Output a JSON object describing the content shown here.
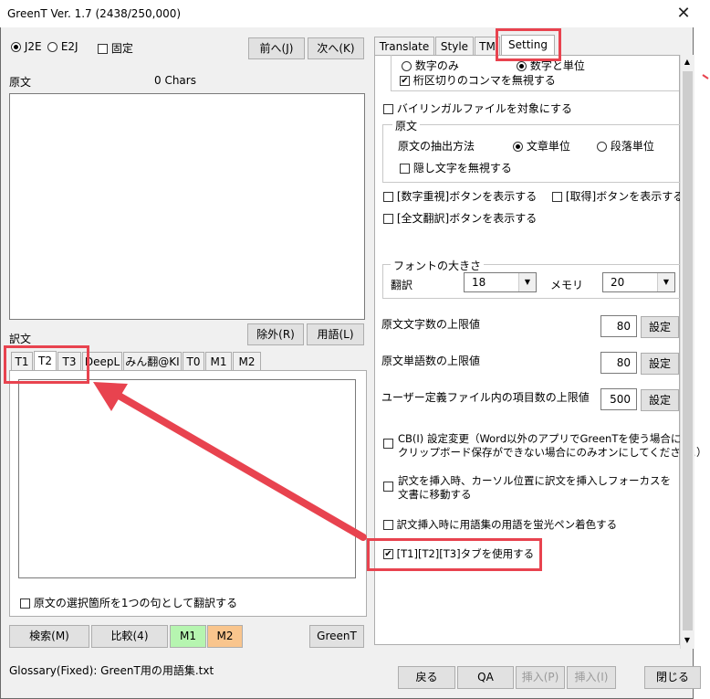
{
  "window": {
    "title": "GreenT Ver. 1.7 (2438/250,000)",
    "close_glyph": "✕"
  },
  "left": {
    "radio_j2e": "J2E",
    "radio_e2j": "E2J",
    "fixed_checkbox": "固定",
    "prev_button": "前へ(J)",
    "next_button": "次へ(K)",
    "source_label": "原文",
    "char_count": "0 Chars",
    "exclude_button": "除外(R)",
    "terms_button": "用語(L)",
    "translation_label": "訳文",
    "tabs": [
      "T1",
      "T2",
      "T3",
      "DeepL",
      "みん翻@KI",
      "T0",
      "M1",
      "M2"
    ],
    "translate_selection_checkbox": "原文の選択箇所を1つの句として翻訳する",
    "search_button": "検索(M)",
    "compare_button": "比較(4)",
    "m1_button": "M1",
    "m2_button": "M2",
    "greent_button": "GreenT"
  },
  "status": {
    "glossary": "Glossary(Fixed): GreenT用の用語集.txt",
    "back_button": "戻る",
    "qa_button": "QA",
    "insert_p_button": "挿入(P)",
    "insert_i_button": "挿入(I)",
    "close_button": "閉じる"
  },
  "right": {
    "tabs": [
      "Translate",
      "Style",
      "TM",
      "Setting"
    ],
    "numbers_only": "数字のみ",
    "numbers_units": "数字と単位",
    "ignore_comma": "桁区切りのコンマを無視する",
    "bilingual": "バイリンガルファイルを対象にする",
    "source_group": "原文",
    "extract_method": "原文の抽出方法",
    "sentence_unit": "文章単位",
    "paragraph_unit": "段落単位",
    "ignore_hidden": "隠し文字を無視する",
    "show_number_button": "[数字重視]ボタンを表示する",
    "show_get_button": "[取得]ボタンを表示する",
    "show_full_button": "[全文翻訳]ボタンを表示する",
    "font_group": "フォントの大きさ",
    "translation_font_label": "翻訳",
    "translation_font_value": "18",
    "memory_font_label": "メモリ",
    "memory_font_value": "20",
    "source_char_limit": "原文文字数の上限値",
    "source_char_value": "80",
    "source_word_limit": "原文単語数の上限値",
    "source_word_value": "80",
    "user_def_limit": "ユーザー定義ファイル内の項目数の上限値",
    "user_def_value": "500",
    "set_button": "設定",
    "cb_change_line1": "CB(I) 設定変更（Word以外のアプリでGreenTを使う場合に",
    "cb_change_line2": "クリップボード保存ができない場合にのみオンにしてください。）",
    "insert_cursor_line1": "訳文を挿入時、カーソル位置に訳文を挿入しフォーカスを",
    "insert_cursor_line2": "文書に移動する",
    "highlight_terms": "訳文挿入時に用語集の用語を蛍光ペン着色する",
    "use_t_tabs": "[T1][T2][T3]タブを使用する"
  },
  "colors": {
    "accent_red": "#e8434f",
    "m1_green": "#b6f5b0",
    "m2_orange": "#f9c58d"
  }
}
